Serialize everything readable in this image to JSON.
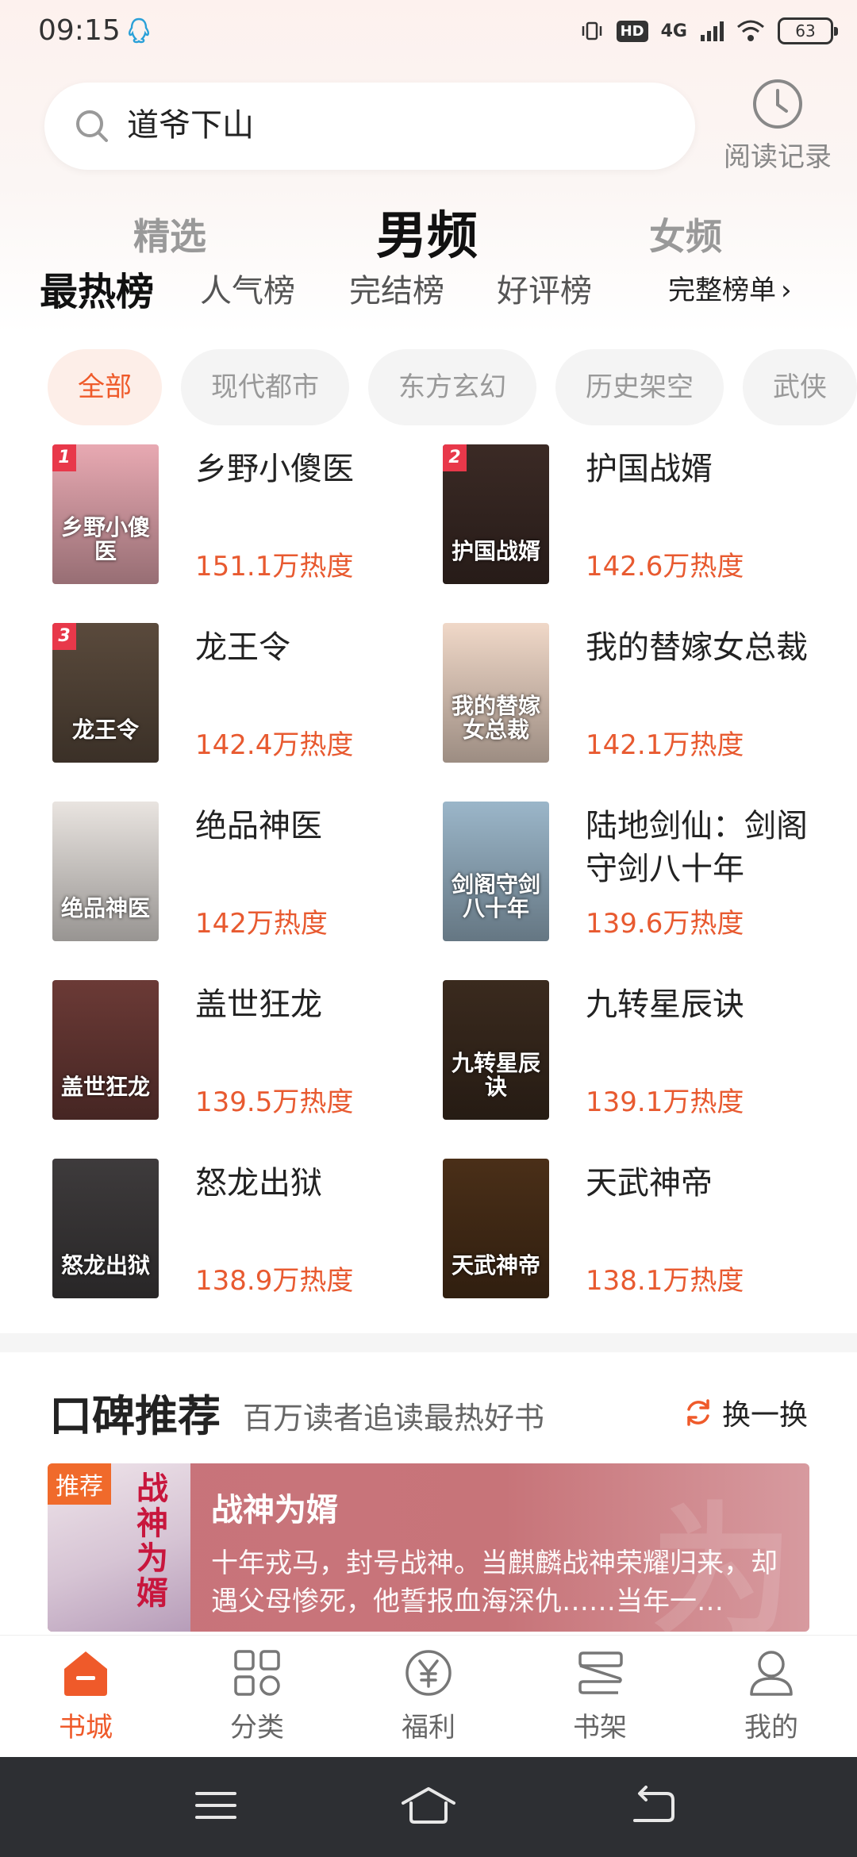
{
  "status_bar": {
    "time": "09:15",
    "battery": "63",
    "hd": "HD",
    "network": "4G"
  },
  "search": {
    "query": "道爷下山"
  },
  "history": {
    "label": "阅读记录"
  },
  "channels": [
    "精选",
    "男频",
    "女频"
  ],
  "rank_tabs": [
    "最热榜",
    "人气榜",
    "完结榜",
    "好评榜"
  ],
  "full_list_label": "完整榜单",
  "categories": [
    "全部",
    "现代都市",
    "东方玄幻",
    "历史架空",
    "武侠"
  ],
  "books": [
    {
      "rank": "1",
      "title": "乡野小傻医",
      "heat": "151.1万热度",
      "cover_text": "乡野小傻医",
      "cover_color": "#e8a9b2"
    },
    {
      "rank": "2",
      "title": "护国战婿",
      "heat": "142.6万热度",
      "cover_text": "护国战婿",
      "cover_color": "#3b2a25"
    },
    {
      "rank": "3",
      "title": "龙王令",
      "heat": "142.4万热度",
      "cover_text": "龙王令",
      "cover_color": "#5a4a3c"
    },
    {
      "rank": "",
      "title": "我的替嫁女总裁",
      "heat": "142.1万热度",
      "cover_text": "我的替嫁女总裁",
      "cover_color": "#f0d8c8"
    },
    {
      "rank": "",
      "title": "绝品神医",
      "heat": "142万热度",
      "cover_text": "绝品神医",
      "cover_color": "#e9e4e0"
    },
    {
      "rank": "",
      "title": "陆地剑仙：剑阁守剑八十年",
      "heat": "139.6万热度",
      "cover_text": "剑阁守剑八十年",
      "cover_color": "#9bb6c9"
    },
    {
      "rank": "",
      "title": "盖世狂龙",
      "heat": "139.5万热度",
      "cover_text": "盖世狂龙",
      "cover_color": "#6b3a36"
    },
    {
      "rank": "",
      "title": "九转星辰诀",
      "heat": "139.1万热度",
      "cover_text": "九转星辰诀",
      "cover_color": "#3a2a1e"
    },
    {
      "rank": "",
      "title": "怒龙出狱",
      "heat": "138.9万热度",
      "cover_text": "怒龙出狱",
      "cover_color": "#3e3b3c"
    },
    {
      "rank": "",
      "title": "天武神帝",
      "heat": "138.1万热度",
      "cover_text": "天武神帝",
      "cover_color": "#4a2f18"
    }
  ],
  "recommend": {
    "title": "口碑推荐",
    "subtitle": "百万读者追读最热好书",
    "refresh_label": "换一换",
    "tag": "推荐",
    "book_title": "战神为婿",
    "cover_title": "战神为婿",
    "description": "十年戎马，封号战神。当麒麟战神荣耀归来，却遇父母惨死，他誓报血海深仇……当年一…"
  },
  "bottom_nav": [
    "书城",
    "分类",
    "福利",
    "书架",
    "我的"
  ],
  "accent_color": "#ef5a2a"
}
